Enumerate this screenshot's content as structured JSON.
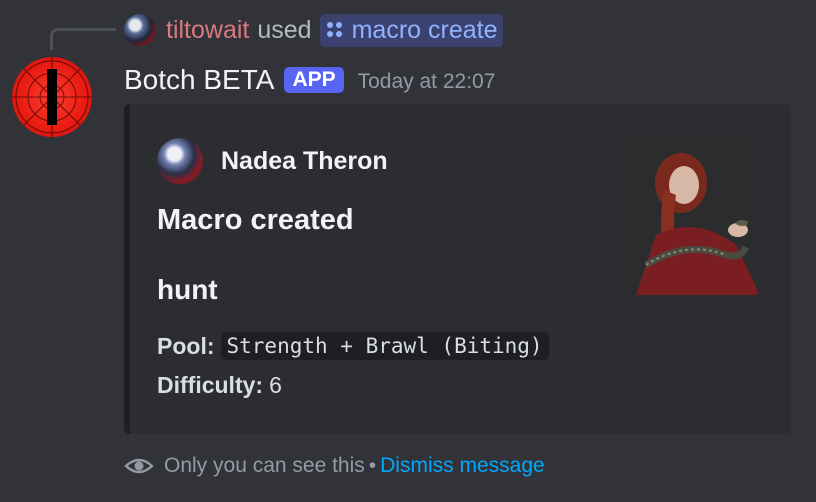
{
  "reply": {
    "username": "tiltowait",
    "used_text": "used",
    "command": "macro create"
  },
  "message": {
    "bot_name": "Botch BETA",
    "badge": "APP",
    "timestamp": "Today at 22:07"
  },
  "embed": {
    "author": "Nadea Theron",
    "title": "Macro created",
    "field_name": "hunt",
    "pool_label": "Pool:",
    "pool_value": "Strength + Brawl (Biting)",
    "difficulty_label": "Difficulty:",
    "difficulty_value": "6"
  },
  "footer": {
    "only_you": "Only you can see this",
    "separator": "•",
    "dismiss": "Dismiss message"
  },
  "colors": {
    "background": "#313338",
    "embed_bg": "#2b2d31",
    "badge": "#5865f2",
    "username": "#d97a7f",
    "link": "#00a8fc"
  },
  "icons": [
    "command-icon",
    "eye-icon"
  ]
}
